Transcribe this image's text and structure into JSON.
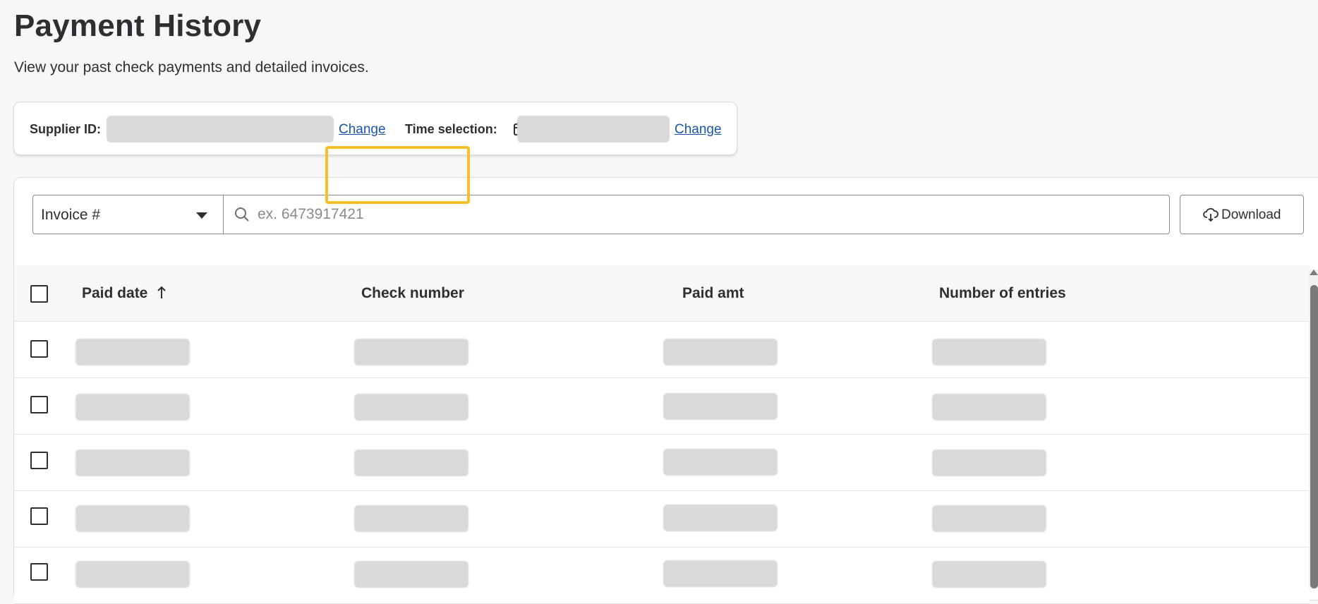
{
  "page": {
    "title": "Payment History",
    "subtitle": "View your past check payments and detailed invoices."
  },
  "filters": {
    "supplier_label": "Supplier ID:",
    "supplier_change": "Change",
    "time_label": "Time selection:",
    "time_change": "Change",
    "calendar_icon": "calendar-icon"
  },
  "toolbar": {
    "search_type": "Invoice #",
    "search_placeholder": "ex. 6473917421",
    "search_value": "",
    "download_label": "Download",
    "download_icon": "cloud-download-icon",
    "search_icon": "search-icon"
  },
  "table": {
    "columns": [
      {
        "label": "Paid date",
        "sort": "ascending"
      },
      {
        "label": "Check number"
      },
      {
        "label": "Paid amt"
      },
      {
        "label": "Number of entries"
      }
    ],
    "row_count_visible": 5,
    "sort_icon": "arrow-up-icon"
  },
  "colors": {
    "highlight": "#f5c02b",
    "link": "#1a56a8",
    "redacted": "#d9d9d9"
  }
}
